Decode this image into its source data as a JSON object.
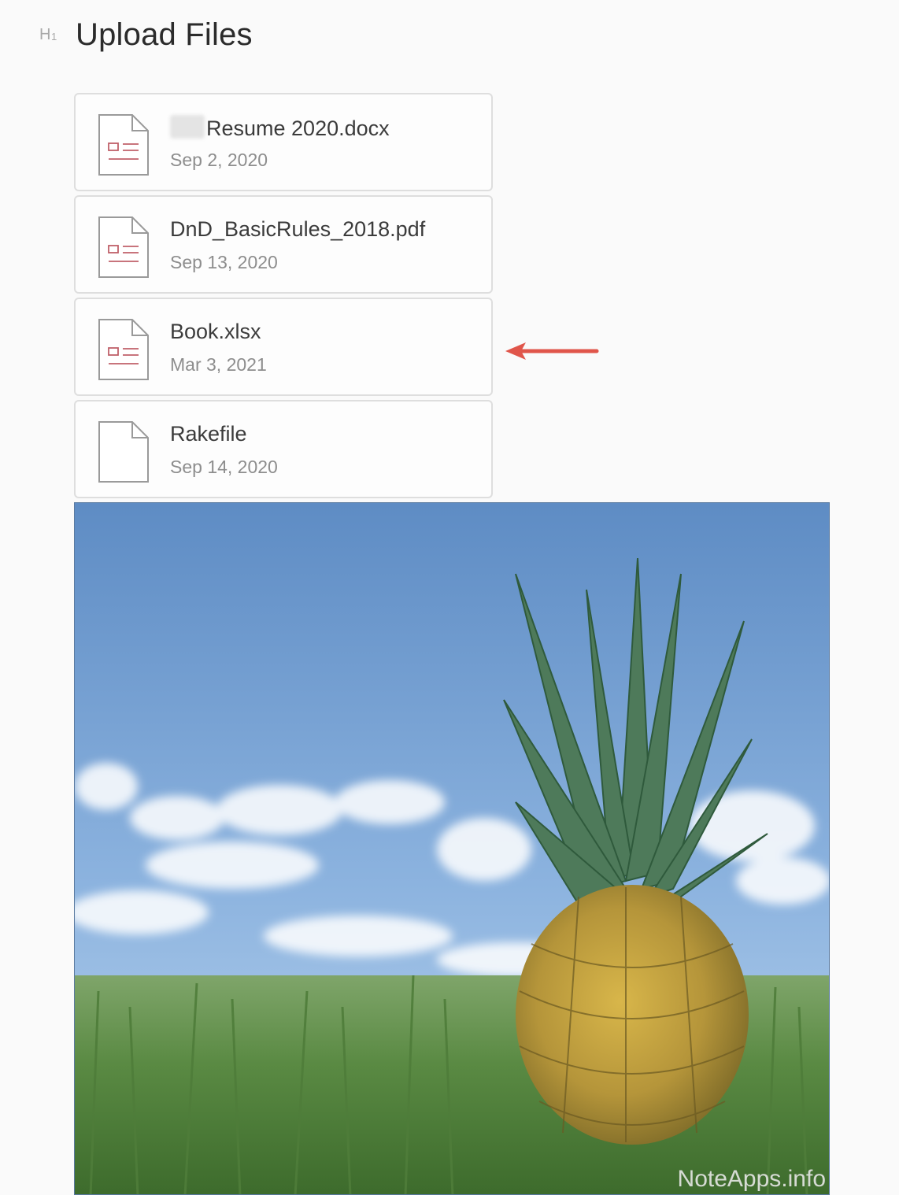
{
  "heading": {
    "badge": "H",
    "badge_level": "1",
    "title": "Upload Files"
  },
  "files": [
    {
      "name": "Resume 2020.docx",
      "date": "Sep 2, 2020",
      "icon": "document-icon"
    },
    {
      "name": "DnD_BasicRules_2018.pdf",
      "date": "Sep 13, 2020",
      "icon": "document-icon"
    },
    {
      "name": "Book.xlsx",
      "date": "Mar 3, 2021",
      "icon": "document-icon"
    },
    {
      "name": "Rakefile",
      "date": "Sep 14, 2020",
      "icon": "blank-file-icon"
    }
  ],
  "annotation": {
    "icon": "arrow-left-icon",
    "color": "#e0554a"
  },
  "image": {
    "subject": "pineapple-photo"
  },
  "watermark": "NoteApps.info",
  "colors": {
    "doc_accent": "#c0606a",
    "card_border": "#dedede",
    "background": "#fafafa"
  }
}
